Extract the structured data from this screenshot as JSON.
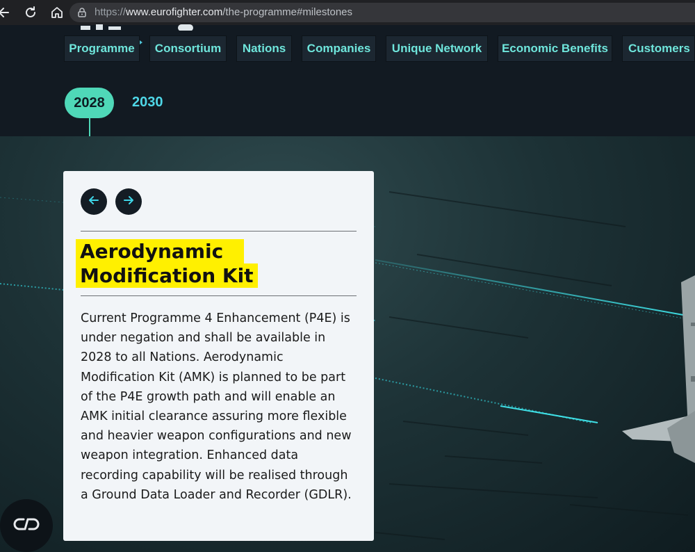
{
  "browser": {
    "url_scheme": "https://",
    "url_host": "www.eurofighter.com",
    "url_path": "/the-programme#milestones",
    "icons": [
      "back-arrow-icon",
      "reload-icon",
      "home-icon",
      "lock-icon"
    ]
  },
  "nav": {
    "tabs": [
      {
        "label": "Programme"
      },
      {
        "label": "Consortium"
      },
      {
        "label": "Nations"
      },
      {
        "label": "Companies"
      },
      {
        "label": "Unique Network"
      },
      {
        "label": "Economic Benefits"
      },
      {
        "label": "Customers"
      }
    ]
  },
  "timeline": {
    "active_year": "2028",
    "next_year": "2030"
  },
  "card": {
    "title_line_1": "Aerodynamic",
    "title_line_2": "Modification Kit",
    "body": "Current Programme 4 Enhancement (P4E) is under negation and shall be available in 2028 to all Nations. Aerodynamic Modification Kit (AMK) is planned to be part of the P4E growth path and will enable an AMK initial clearance assuring more flexible and heavier weapon configurations and new weapon integration. Enhanced data recording capability will be realised through a Ground Data Loader and Recorder (GDLR).",
    "prev_icon": "arrow-left-icon",
    "next_icon": "arrow-right-icon"
  },
  "colors": {
    "accent_teal": "#4fd8b8",
    "nav_text": "#6fe6dc",
    "highlight_yellow": "#fff000",
    "dark": "#121a22"
  }
}
